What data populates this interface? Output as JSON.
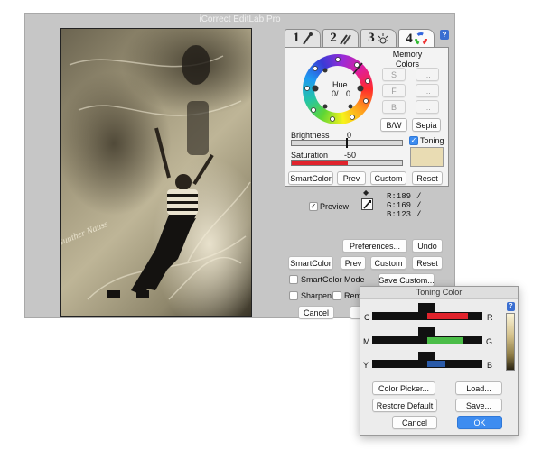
{
  "main_window": {
    "title": "iCorrect EditLab Pro",
    "tabs": [
      {
        "number": "1",
        "icon": "eyedropper-neutral-icon"
      },
      {
        "number": "2",
        "icon": "eyedropper-pair-icon"
      },
      {
        "number": "3",
        "icon": "sun-brightness-icon"
      },
      {
        "number": "4",
        "icon": "color-wheel-icon"
      }
    ],
    "active_tab": "4",
    "memory_colors": {
      "title": "Memory\nColors",
      "slots": [
        {
          "label": "S",
          "value_label": "..."
        },
        {
          "label": "F",
          "value_label": "..."
        },
        {
          "label": "B",
          "value_label": "..."
        }
      ]
    },
    "hue": {
      "label": "Hue",
      "value": "0/",
      "value2": "0"
    },
    "bw_label": "B/W",
    "sepia_label": "Sepia",
    "brightness": {
      "label": "Brightness",
      "value": "0",
      "level": 0.5
    },
    "saturation": {
      "label": "Saturation",
      "value": "-50",
      "level": 0.5
    },
    "toning": {
      "label": "Toning",
      "checked": true,
      "swatch_color": "#e9dcb3"
    },
    "panel_buttons": [
      "SmartColor",
      "Prev",
      "Custom",
      "Reset"
    ],
    "preview": {
      "label": "Preview",
      "checked": true
    },
    "readout": {
      "r": "R:189",
      "g": "G:169",
      "b": "B:123",
      "sep": "/"
    },
    "preferences_label": "Preferences...",
    "undo_label": "Undo",
    "bottom_buttons": [
      "SmartColor",
      "Prev",
      "Custom",
      "Reset"
    ],
    "smartcolor_mode_label": "SmartColor Mode",
    "save_custom_label": "Save Custom...",
    "sharpen_label": "Sharpen",
    "remove_label": "Remo",
    "cancel_label": "Cancel",
    "photo_watermark": "Gunther Nauss"
  },
  "toning_dialog": {
    "title": "Toning Color",
    "sliders": [
      {
        "left": "C",
        "right": "R",
        "fill": "#e0232c",
        "level": 0.7
      },
      {
        "left": "M",
        "right": "G",
        "fill": "#4bbd48",
        "level": 0.7
      },
      {
        "left": "Y",
        "right": "B",
        "fill": "#2a5aa8",
        "level": 0.62
      }
    ],
    "color_picker_label": "Color Picker...",
    "load_label": "Load...",
    "restore_default_label": "Restore Default",
    "save_label": "Save...",
    "cancel_label": "Cancel",
    "ok_label": "OK"
  },
  "colors": {
    "window_bg": "#c6c6c6",
    "panel_bg": "#f3f3f3",
    "saturation_fill": "#e0232c",
    "accent": "#3d8cf0",
    "help_button": "#3a6ed1"
  }
}
